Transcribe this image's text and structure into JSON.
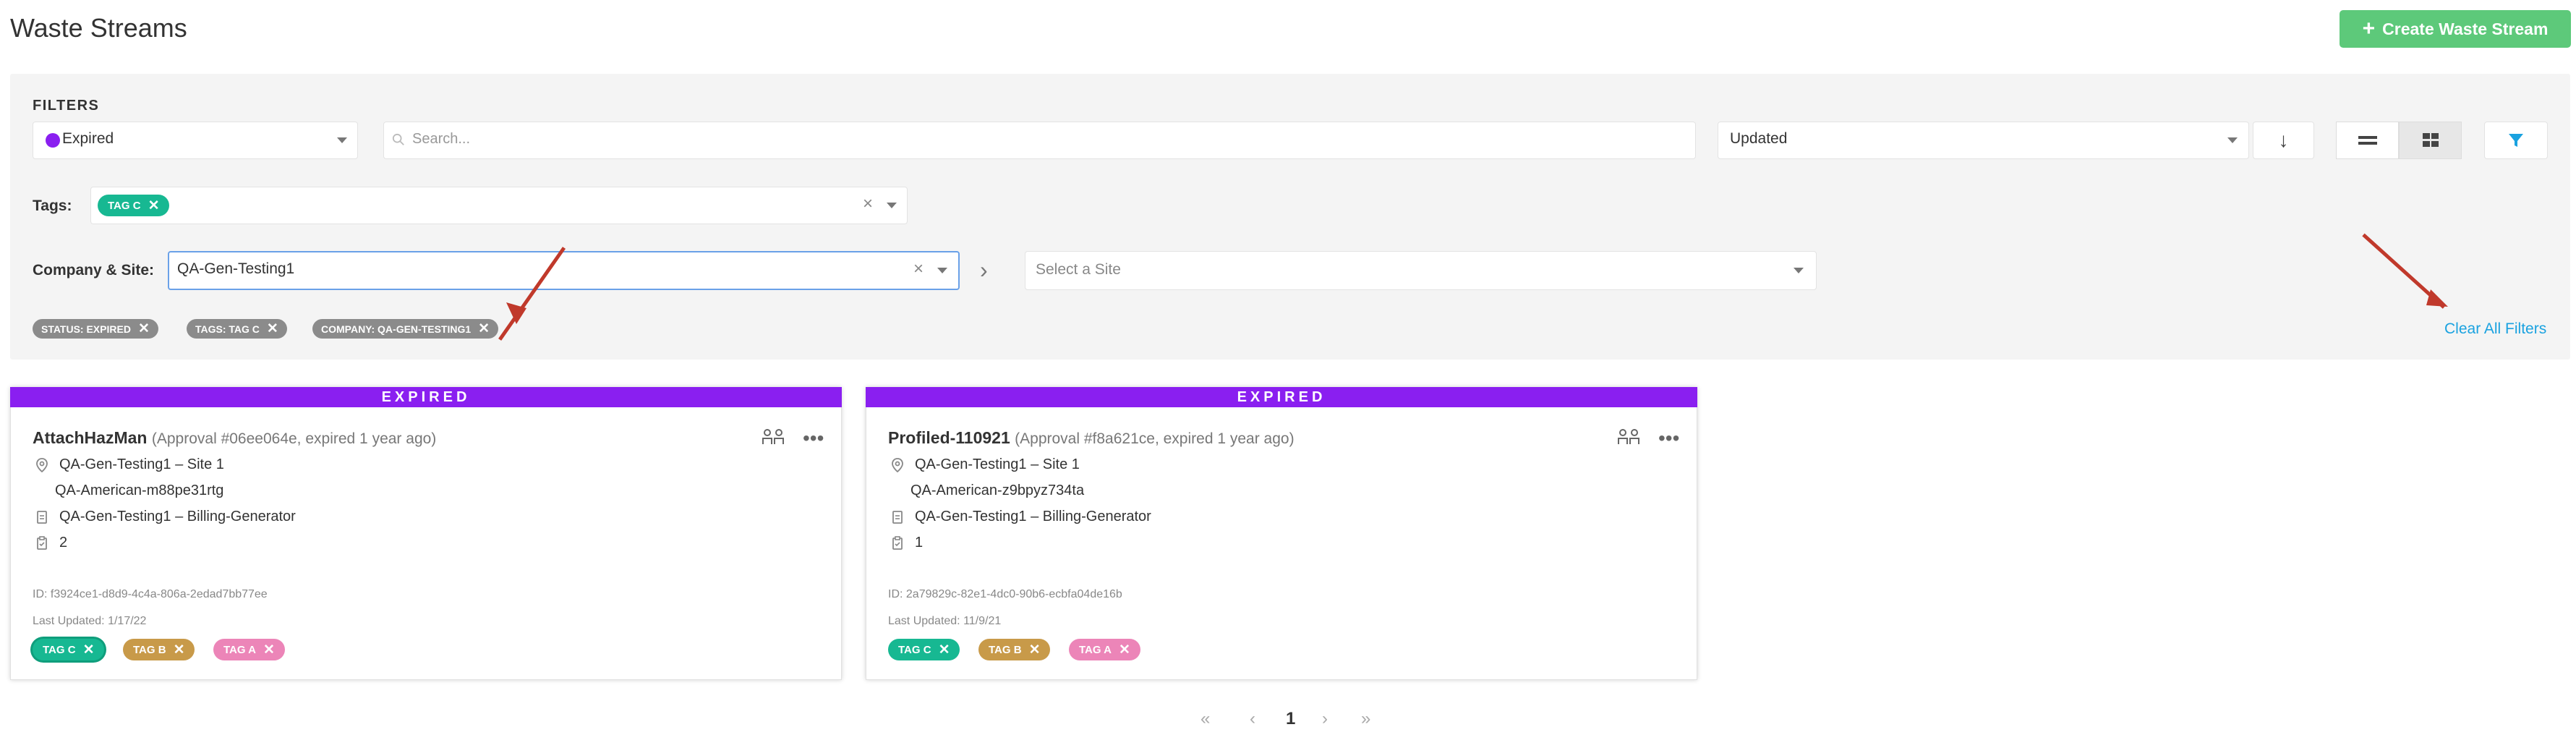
{
  "page": {
    "title": "Waste Streams",
    "create_button": "Create Waste Stream",
    "accent_color": "#5dc97a"
  },
  "filters": {
    "label": "FILTERS",
    "status_value": "Expired",
    "status_color": "#8a1ff0",
    "search_placeholder": "Search...",
    "sort_value": "Updated",
    "tags_label": "Tags:",
    "tags_selected": [
      "TAG C"
    ],
    "company_label": "Company & Site:",
    "company_value": "QA-Gen-Testing1",
    "site_placeholder": "Select a Site",
    "active_chips": [
      "STATUS: EXPIRED",
      "TAGS: TAG C",
      "COMPANY: QA-GEN-TESTING1"
    ],
    "clear_all": "Clear All Filters"
  },
  "cards": [
    {
      "banner": "EXPIRED",
      "title": "AttachHazMan",
      "subtitle": "(Approval #06ee064e, expired 1 year ago)",
      "site": "QA-Gen-Testing1 – Site 1",
      "generator": "QA-American-m88pe31rtg",
      "billing": "QA-Gen-Testing1 – Billing-Generator",
      "count": "2",
      "id": "ID: f3924ce1-d8d9-4c4a-806a-2edad7bb77ee",
      "updated": "Last Updated: 1/17/22",
      "tags": [
        "TAG C",
        "TAG B",
        "TAG A"
      ]
    },
    {
      "banner": "EXPIRED",
      "title": "Profiled-110921",
      "subtitle": "(Approval #f8a621ce, expired 1 year ago)",
      "site": "QA-Gen-Testing1 – Site 1",
      "generator": "QA-American-z9bpyz734ta",
      "billing": "QA-Gen-Testing1 – Billing-Generator",
      "count": "1",
      "id": "ID: 2a79829c-82e1-4dc0-90b6-ecbfa04de16b",
      "updated": "Last Updated: 11/9/21",
      "tags": [
        "TAG C",
        "TAG B",
        "TAG A"
      ]
    }
  ],
  "pagination": {
    "first": "«",
    "prev": "‹",
    "current": "1",
    "next": "›",
    "last": "»"
  },
  "icons": {
    "search": "search-icon",
    "sort_direction": "arrow-down-icon",
    "list_view": "list-view-icon",
    "grid_view": "grid-view-icon",
    "filter": "funnel-icon",
    "location": "map-pin-icon",
    "billing": "document-icon",
    "count": "clipboard-icon",
    "people": "people-icon",
    "more": "more-dots-icon"
  }
}
